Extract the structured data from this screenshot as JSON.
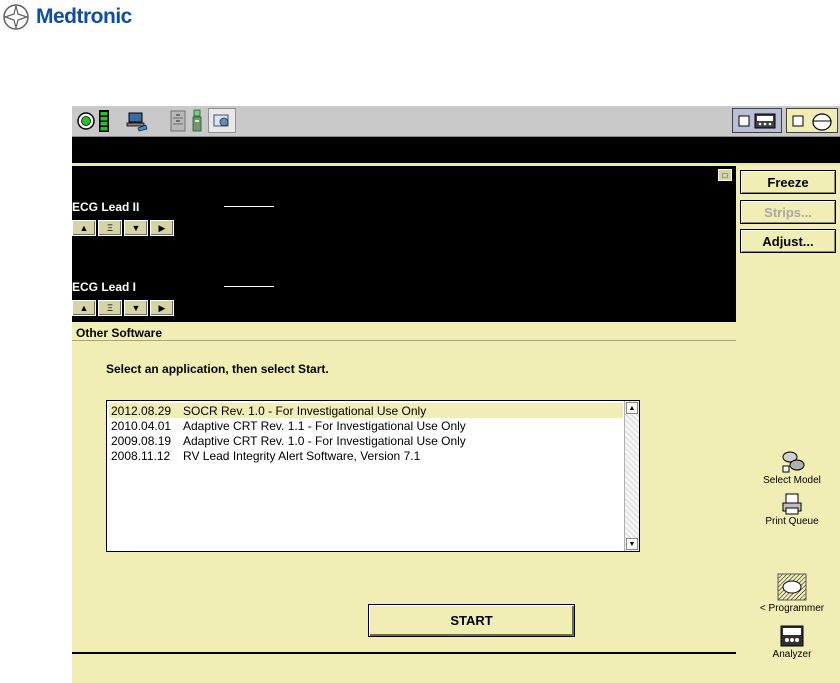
{
  "logo": {
    "text": "Medtronic"
  },
  "ecg": {
    "leads": [
      {
        "label": "ECG Lead II"
      },
      {
        "label": "ECG Lead I"
      }
    ],
    "buttons": {
      "up": "▲",
      "wave": "Ξ",
      "down": "▼",
      "right": "▶"
    }
  },
  "side_buttons": {
    "freeze": "Freeze",
    "strips": "Strips...",
    "adjust": "Adjust..."
  },
  "panel": {
    "title": "Other Software",
    "instruction": "Select an application, then select Start."
  },
  "software_list": [
    {
      "date": "2012.08.29",
      "name": "SOCR Rev. 1.0 - For Investigational Use Only",
      "selected": true
    },
    {
      "date": "2010.04.01",
      "name": "Adaptive CRT Rev. 1.1 - For Investigational Use Only",
      "selected": false
    },
    {
      "date": "2009.08.19",
      "name": "Adaptive CRT Rev. 1.0 - For Investigational Use Only",
      "selected": false
    },
    {
      "date": "2008.11.12",
      "name": "RV Lead Integrity Alert Software, Version 7.1",
      "selected": false
    }
  ],
  "start_label": "START",
  "side_icons": {
    "select_model": "Select Model",
    "print_queue": "Print Queue",
    "programmer": "< Programmer",
    "analyzer": "Analyzer"
  },
  "colors": {
    "app_bg": "#f0eeb4",
    "ecg_bg": "#000000",
    "brand": "#0d4fa0",
    "selected_row": "#f0eeb4",
    "battery": "#27c227"
  }
}
